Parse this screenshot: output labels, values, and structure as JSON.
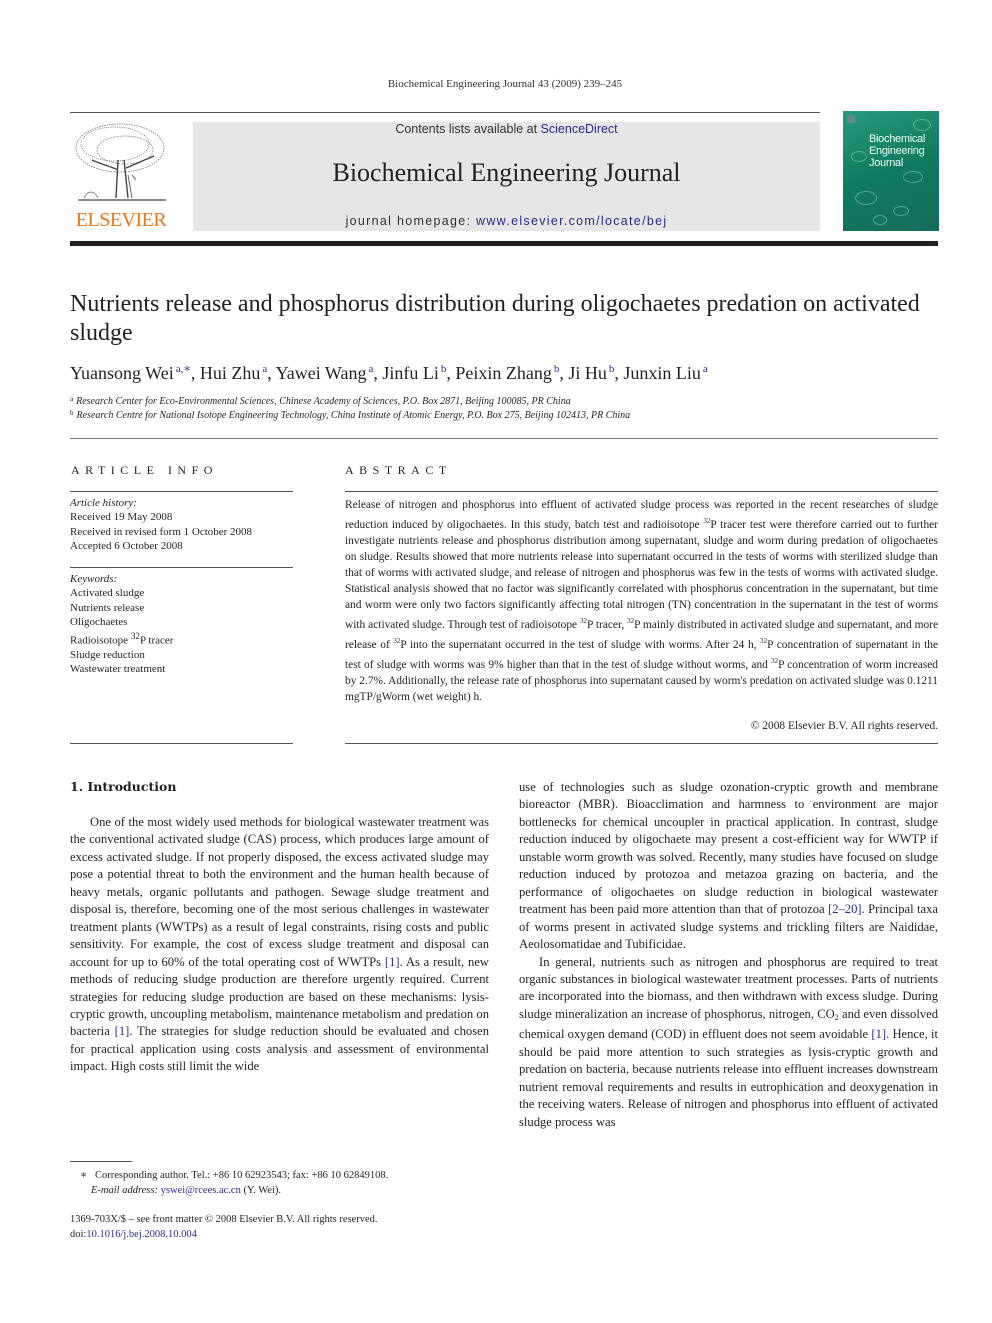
{
  "running_head": "Biochemical Engineering Journal 43 (2009) 239–245",
  "header": {
    "publisher_logo_text": "ELSEVIER",
    "contents_prefix": "Contents lists available at ",
    "contents_link": "ScienceDirect",
    "journal_title": "Biochemical Engineering Journal",
    "homepage_prefix": "journal homepage: ",
    "homepage_link": "www.elsevier.com/locate/bej",
    "cover_title_lines": [
      "Biochemical",
      "Engineering",
      "Journal"
    ]
  },
  "article": {
    "title": "Nutrients release and phosphorus distribution during oligochaetes predation on activated sludge",
    "authors": [
      {
        "name": "Yuansong Wei",
        "aff": "a,∗"
      },
      {
        "name": "Hui Zhu",
        "aff": "a"
      },
      {
        "name": "Yawei Wang",
        "aff": "a"
      },
      {
        "name": "Jinfu Li",
        "aff": "b"
      },
      {
        "name": "Peixin Zhang",
        "aff": "b"
      },
      {
        "name": "Ji Hu",
        "aff": "b"
      },
      {
        "name": "Junxin Liu",
        "aff": "a"
      }
    ],
    "affiliations": [
      {
        "label": "a",
        "text": "Research Center for Eco-Environmental Sciences, Chinese Academy of Sciences, P.O. Box 2871, Beijing 100085, PR China"
      },
      {
        "label": "b",
        "text": "Research Centre for National Isotope Engineering Technology, China Institute of Atomic Energy, P.O. Box 275, Beijing 102413, PR China"
      }
    ]
  },
  "article_info": {
    "heading": "ARTICLE INFO",
    "history_label": "Article history:",
    "history": [
      "Received 19 May 2008",
      "Received in revised form 1 October 2008",
      "Accepted 6 October 2008"
    ],
    "keywords_label": "Keywords:",
    "keywords": [
      "Activated sludge",
      "Nutrients release",
      "Oligochaetes",
      "Radioisotope 32P tracer",
      "Sludge reduction",
      "Wastewater treatment"
    ]
  },
  "abstract": {
    "heading": "ABSTRACT",
    "text": "Release of nitrogen and phosphorus into effluent of activated sludge process was reported in the recent researches of sludge reduction induced by oligochaetes. In this study, batch test and radioisotope 32P tracer test were therefore carried out to further investigate nutrients release and phosphorus distribution among supernatant, sludge and worm during predation of oligochaetes on sludge. Results showed that more nutrients release into supernatant occurred in the tests of worms with sterilized sludge than that of worms with activated sludge, and release of nitrogen and phosphorus was few in the tests of worms with activated sludge. Statistical analysis showed that no factor was significantly correlated with phosphorus concentration in the supernatant, but time and worm were only two factors significantly affecting total nitrogen (TN) concentration in the supernatant in the test of worms with activated sludge. Through test of radioisotope 32P tracer, 32P mainly distributed in activated sludge and supernatant, and more release of 32P into the supernatant occurred in the test of sludge with worms. After 24 h, 32P concentration of supernatant in the test of sludge with worms was 9% higher than that in the test of sludge without worms, and 32P concentration of worm increased by 2.7%. Additionally, the release rate of phosphorus into supernatant caused by worm's predation on activated sludge was 0.1211 mgTP/gWorm (wet weight) h.",
    "copyright": "© 2008 Elsevier B.V. All rights reserved."
  },
  "introduction": {
    "heading": "1.  Introduction",
    "col1_p1": "One of the most widely used methods for biological wastewater treatment was the conventional activated sludge (CAS) process, which produces large amount of excess activated sludge. If not properly disposed, the excess activated sludge may pose a potential threat to both the environment and the human health because of heavy metals, organic pollutants and pathogen. Sewage sludge treatment and disposal is, therefore, becoming one of the most serious challenges in wastewater treatment plants (WWTPs) as a result of legal constraints, rising costs and public sensitivity. For example, the cost of excess sludge treatment and disposal can account for up to 60% of the total operating cost of WWTPs [1]. As a result, new methods of reducing sludge production are therefore urgently required. Current strategies for reducing sludge production are based on these mechanisms: lysis-cryptic growth, uncoupling metabolism, maintenance metabolism and predation on bacteria [1]. The strategies for sludge reduction should be evaluated and chosen for practical application using costs analysis and assessment of environmental impact. High costs still limit the wide",
    "col2_p1": "use of technologies such as sludge ozonation-cryptic growth and membrane bioreactor (MBR). Bioacclimation and harmness to environment are major bottlenecks for chemical uncoupler in practical application. In contrast, sludge reduction induced by oligochaete may present a cost-efficient way for WWTP if unstable worm growth was solved. Recently, many studies have focused on sludge reduction induced by protozoa and metazoa grazing on bacteria, and the performance of oligochaetes on sludge reduction in biological wastewater treatment has been paid more attention than that of protozoa [2–20]. Principal taxa of worms present in activated sludge systems and trickling filters are Naididae, Aeolosomatidae and Tubificidae.",
    "col2_p2": "In general, nutrients such as nitrogen and phosphorus are required to treat organic substances in biological wastewater treatment processes. Parts of nutrients are incorporated into the biomass, and then withdrawn with excess sludge. During sludge mineralization an increase of phosphorus, nitrogen, CO2 and even dissolved chemical oxygen demand (COD) in effluent does not seem avoidable [1]. Hence, it should be paid more attention to such strategies as lysis-cryptic growth and predation on bacteria, because nutrients release into effluent increases downstream nutrient removal requirements and results in eutrophication and deoxygenation in the receiving waters. Release of nitrogen and phosphorus into effluent of activated sludge process was"
  },
  "footnote": {
    "marker": "∗",
    "corresponding": "Corresponding author. Tel.: +86 10 62923543; fax: +86 10 62849108.",
    "email_label": "E-mail address: ",
    "email": "yswei@rcees.ac.cn",
    "email_suffix": " (Y. Wei).",
    "issn_line": "1369-703X/$ – see front matter © 2008 Elsevier B.V. All rights reserved.",
    "doi_prefix": "doi:",
    "doi": "10.1016/j.bej.2008.10.004"
  },
  "colors": {
    "link": "#2b2b8c",
    "elsevier_orange": "#e87722",
    "banner_gray": "#e6e6e6",
    "cover_green": "#0f7a5e"
  }
}
